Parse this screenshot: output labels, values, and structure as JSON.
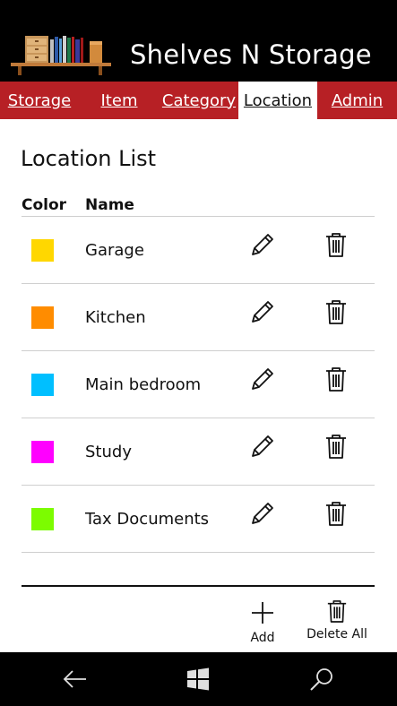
{
  "app": {
    "title": "Shelves N Storage"
  },
  "nav": {
    "items": [
      {
        "label": "Storage",
        "active": false
      },
      {
        "label": "Item",
        "active": false
      },
      {
        "label": "Category",
        "active": false
      },
      {
        "label": "Location",
        "active": true
      },
      {
        "label": "Admin",
        "active": false
      }
    ]
  },
  "page": {
    "title": "Location List",
    "columns": {
      "color": "Color",
      "name": "Name"
    }
  },
  "locations": [
    {
      "name": "Garage",
      "color": "#ffd700"
    },
    {
      "name": "Kitchen",
      "color": "#ff8c00"
    },
    {
      "name": "Main bedroom",
      "color": "#00bfff"
    },
    {
      "name": "Study",
      "color": "#ff00ff"
    },
    {
      "name": "Tax Documents",
      "color": "#7cfc00"
    }
  ],
  "icons": {
    "edit": "pencil-icon",
    "delete": "trash-icon",
    "add": "plus-icon",
    "back": "back-arrow-icon",
    "start": "windows-icon",
    "search": "search-icon"
  },
  "actions": {
    "add_label": "Add",
    "delete_all_label": "Delete All"
  },
  "theme": {
    "header_bg": "#000000",
    "nav_bg": "#b72025",
    "text": "#111111"
  }
}
